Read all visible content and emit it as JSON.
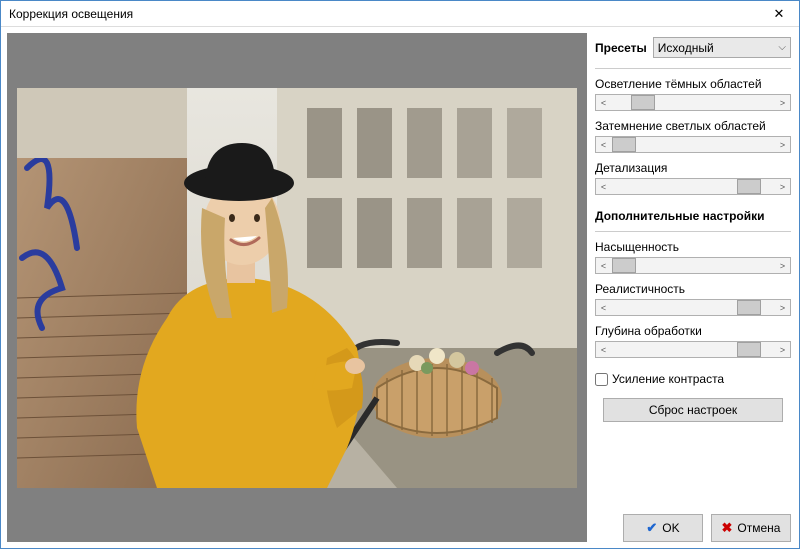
{
  "window": {
    "title": "Коррекция освещения"
  },
  "presets": {
    "label": "Пресеты",
    "selected": "Исходный"
  },
  "sliders": {
    "lighten_dark": {
      "label": "Осветление тёмных областей",
      "pos": 18
    },
    "darken_light": {
      "label": "Затемнение светлых областей",
      "pos": 8
    },
    "detail": {
      "label": "Детализация",
      "pos": 85
    }
  },
  "advanced": {
    "header": "Дополнительные настройки",
    "saturation": {
      "label": "Насыщенность",
      "pos": 8
    },
    "realism": {
      "label": "Реалистичность",
      "pos": 85
    },
    "depth": {
      "label": "Глубина обработки",
      "pos": 85
    }
  },
  "contrast": {
    "label": "Усиление контраста",
    "checked": false
  },
  "buttons": {
    "reset": "Сброс настроек",
    "ok": "OK",
    "cancel": "Отмена"
  }
}
